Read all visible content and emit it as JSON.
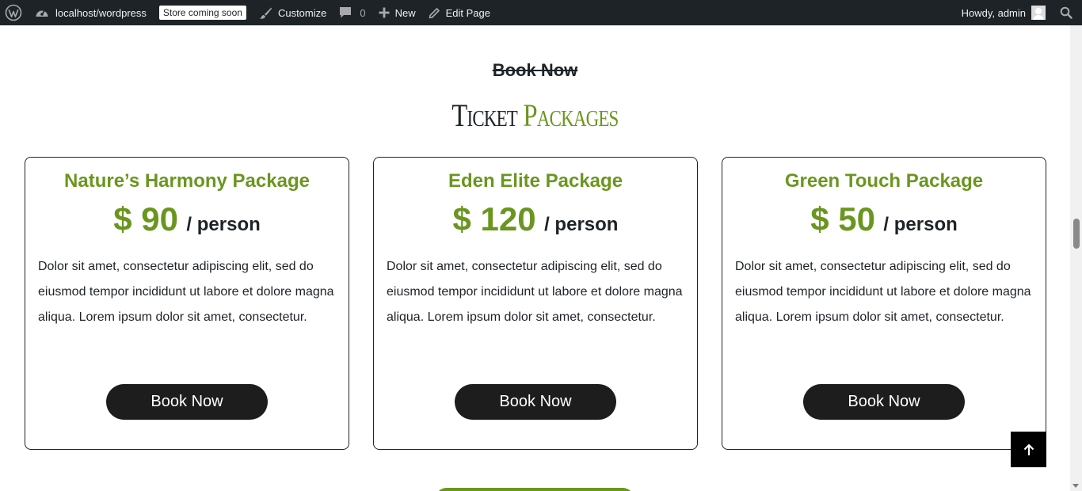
{
  "adminbar": {
    "site": "localhost/wordpress",
    "badge": "Store coming soon",
    "customize": "Customize",
    "comments_count": "0",
    "new": "New",
    "edit_page": "Edit Page",
    "howdy": "Howdy, admin"
  },
  "section": {
    "strike_title": "Book Now",
    "title_part1": "Ticket",
    "title_part2": "Packages"
  },
  "packages": [
    {
      "name": "Nature’s Harmony Package",
      "price": "$ 90",
      "unit": "/ person",
      "description": "Dolor sit amet, consectetur adipiscing elit, sed do eiusmod tempor incididunt ut labore et dolore magna aliqua. Lorem ipsum dolor sit amet, consectetur.",
      "button": "Book Now"
    },
    {
      "name": "Eden Elite Package",
      "price": "$ 120",
      "unit": "/ person",
      "description": "Dolor sit amet, consectetur adipiscing elit, sed do eiusmod tempor incididunt ut labore et dolore magna aliqua. Lorem ipsum dolor sit amet, consectetur.",
      "button": "Book Now"
    },
    {
      "name": "Green Touch Package",
      "price": "$ 50",
      "unit": "/ person",
      "description": "Dolor sit amet, consectetur adipiscing elit, sed do eiusmod tempor incididunt ut labore et dolore magna aliqua. Lorem ipsum dolor sit amet, consectetur.",
      "button": "Book Now"
    }
  ],
  "colors": {
    "accent_green": "#6a961f",
    "dark": "#1d2327",
    "admin_bar": "#1d2327"
  },
  "icons": {
    "wp_logo": "wordpress-icon",
    "site": "dashboard-icon",
    "customize": "brush-icon",
    "comments": "comment-icon",
    "new": "plus-icon",
    "edit": "pencil-icon",
    "search": "search-icon",
    "back_to_top": "arrow-up-icon"
  }
}
